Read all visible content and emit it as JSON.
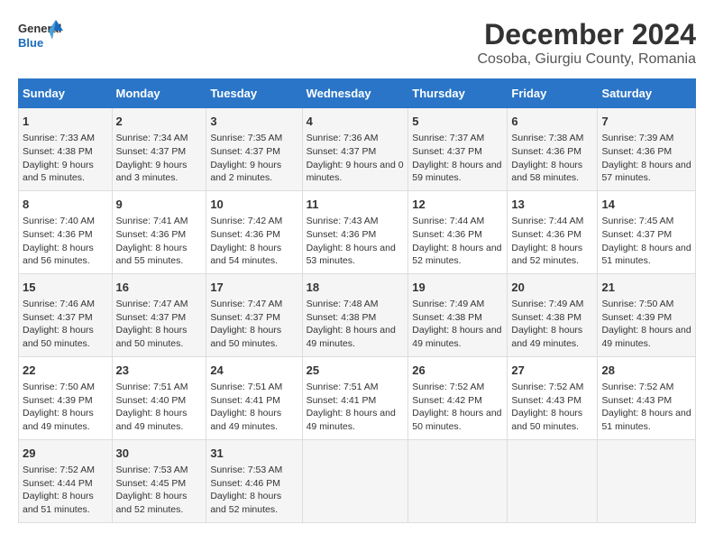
{
  "logo": {
    "line1": "General",
    "line2": "Blue"
  },
  "title": "December 2024",
  "subtitle": "Cosoba, Giurgiu County, Romania",
  "days_header": [
    "Sunday",
    "Monday",
    "Tuesday",
    "Wednesday",
    "Thursday",
    "Friday",
    "Saturday"
  ],
  "weeks": [
    [
      {
        "day": "1",
        "sunrise": "Sunrise: 7:33 AM",
        "sunset": "Sunset: 4:38 PM",
        "daylight": "Daylight: 9 hours and 5 minutes."
      },
      {
        "day": "2",
        "sunrise": "Sunrise: 7:34 AM",
        "sunset": "Sunset: 4:37 PM",
        "daylight": "Daylight: 9 hours and 3 minutes."
      },
      {
        "day": "3",
        "sunrise": "Sunrise: 7:35 AM",
        "sunset": "Sunset: 4:37 PM",
        "daylight": "Daylight: 9 hours and 2 minutes."
      },
      {
        "day": "4",
        "sunrise": "Sunrise: 7:36 AM",
        "sunset": "Sunset: 4:37 PM",
        "daylight": "Daylight: 9 hours and 0 minutes."
      },
      {
        "day": "5",
        "sunrise": "Sunrise: 7:37 AM",
        "sunset": "Sunset: 4:37 PM",
        "daylight": "Daylight: 8 hours and 59 minutes."
      },
      {
        "day": "6",
        "sunrise": "Sunrise: 7:38 AM",
        "sunset": "Sunset: 4:36 PM",
        "daylight": "Daylight: 8 hours and 58 minutes."
      },
      {
        "day": "7",
        "sunrise": "Sunrise: 7:39 AM",
        "sunset": "Sunset: 4:36 PM",
        "daylight": "Daylight: 8 hours and 57 minutes."
      }
    ],
    [
      {
        "day": "8",
        "sunrise": "Sunrise: 7:40 AM",
        "sunset": "Sunset: 4:36 PM",
        "daylight": "Daylight: 8 hours and 56 minutes."
      },
      {
        "day": "9",
        "sunrise": "Sunrise: 7:41 AM",
        "sunset": "Sunset: 4:36 PM",
        "daylight": "Daylight: 8 hours and 55 minutes."
      },
      {
        "day": "10",
        "sunrise": "Sunrise: 7:42 AM",
        "sunset": "Sunset: 4:36 PM",
        "daylight": "Daylight: 8 hours and 54 minutes."
      },
      {
        "day": "11",
        "sunrise": "Sunrise: 7:43 AM",
        "sunset": "Sunset: 4:36 PM",
        "daylight": "Daylight: 8 hours and 53 minutes."
      },
      {
        "day": "12",
        "sunrise": "Sunrise: 7:44 AM",
        "sunset": "Sunset: 4:36 PM",
        "daylight": "Daylight: 8 hours and 52 minutes."
      },
      {
        "day": "13",
        "sunrise": "Sunrise: 7:44 AM",
        "sunset": "Sunset: 4:36 PM",
        "daylight": "Daylight: 8 hours and 52 minutes."
      },
      {
        "day": "14",
        "sunrise": "Sunrise: 7:45 AM",
        "sunset": "Sunset: 4:37 PM",
        "daylight": "Daylight: 8 hours and 51 minutes."
      }
    ],
    [
      {
        "day": "15",
        "sunrise": "Sunrise: 7:46 AM",
        "sunset": "Sunset: 4:37 PM",
        "daylight": "Daylight: 8 hours and 50 minutes."
      },
      {
        "day": "16",
        "sunrise": "Sunrise: 7:47 AM",
        "sunset": "Sunset: 4:37 PM",
        "daylight": "Daylight: 8 hours and 50 minutes."
      },
      {
        "day": "17",
        "sunrise": "Sunrise: 7:47 AM",
        "sunset": "Sunset: 4:37 PM",
        "daylight": "Daylight: 8 hours and 50 minutes."
      },
      {
        "day": "18",
        "sunrise": "Sunrise: 7:48 AM",
        "sunset": "Sunset: 4:38 PM",
        "daylight": "Daylight: 8 hours and 49 minutes."
      },
      {
        "day": "19",
        "sunrise": "Sunrise: 7:49 AM",
        "sunset": "Sunset: 4:38 PM",
        "daylight": "Daylight: 8 hours and 49 minutes."
      },
      {
        "day": "20",
        "sunrise": "Sunrise: 7:49 AM",
        "sunset": "Sunset: 4:38 PM",
        "daylight": "Daylight: 8 hours and 49 minutes."
      },
      {
        "day": "21",
        "sunrise": "Sunrise: 7:50 AM",
        "sunset": "Sunset: 4:39 PM",
        "daylight": "Daylight: 8 hours and 49 minutes."
      }
    ],
    [
      {
        "day": "22",
        "sunrise": "Sunrise: 7:50 AM",
        "sunset": "Sunset: 4:39 PM",
        "daylight": "Daylight: 8 hours and 49 minutes."
      },
      {
        "day": "23",
        "sunrise": "Sunrise: 7:51 AM",
        "sunset": "Sunset: 4:40 PM",
        "daylight": "Daylight: 8 hours and 49 minutes."
      },
      {
        "day": "24",
        "sunrise": "Sunrise: 7:51 AM",
        "sunset": "Sunset: 4:41 PM",
        "daylight": "Daylight: 8 hours and 49 minutes."
      },
      {
        "day": "25",
        "sunrise": "Sunrise: 7:51 AM",
        "sunset": "Sunset: 4:41 PM",
        "daylight": "Daylight: 8 hours and 49 minutes."
      },
      {
        "day": "26",
        "sunrise": "Sunrise: 7:52 AM",
        "sunset": "Sunset: 4:42 PM",
        "daylight": "Daylight: 8 hours and 50 minutes."
      },
      {
        "day": "27",
        "sunrise": "Sunrise: 7:52 AM",
        "sunset": "Sunset: 4:43 PM",
        "daylight": "Daylight: 8 hours and 50 minutes."
      },
      {
        "day": "28",
        "sunrise": "Sunrise: 7:52 AM",
        "sunset": "Sunset: 4:43 PM",
        "daylight": "Daylight: 8 hours and 51 minutes."
      }
    ],
    [
      {
        "day": "29",
        "sunrise": "Sunrise: 7:52 AM",
        "sunset": "Sunset: 4:44 PM",
        "daylight": "Daylight: 8 hours and 51 minutes."
      },
      {
        "day": "30",
        "sunrise": "Sunrise: 7:53 AM",
        "sunset": "Sunset: 4:45 PM",
        "daylight": "Daylight: 8 hours and 52 minutes."
      },
      {
        "day": "31",
        "sunrise": "Sunrise: 7:53 AM",
        "sunset": "Sunset: 4:46 PM",
        "daylight": "Daylight: 8 hours and 52 minutes."
      },
      null,
      null,
      null,
      null
    ]
  ]
}
